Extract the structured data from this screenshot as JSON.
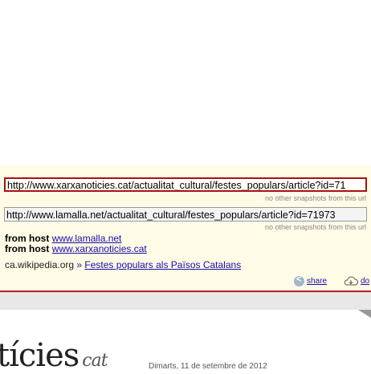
{
  "archive_panel": {
    "url_1": "http://www.xarxanoticies.cat/actualitat_cultural/festes_populars/article?id=71",
    "url_1_note": "no other snapshots from this url",
    "url_2": "http://www.lamalla.net/actualitat_cultural/festes_populars/article?id=71973",
    "url_2_note": "no other snapshots from this url",
    "from_host_label": "from host",
    "host_1": "www.lamalla.net",
    "host_2": "www.xarxanoticies.cat",
    "wiki_source": "ca.wikipedia.org",
    "wiki_sep": "»",
    "wiki_link": "Festes populars als Països Catalans",
    "share_label": "share",
    "download_label": "do"
  },
  "page": {
    "logo_text": "tícies",
    "logo_suffix": "cat",
    "date": "Dimarts, 11 de setembre de 2012"
  },
  "colors": {
    "accent": "#b22222",
    "link": "#1a0dab",
    "panel_bg": "#fffbe6"
  }
}
